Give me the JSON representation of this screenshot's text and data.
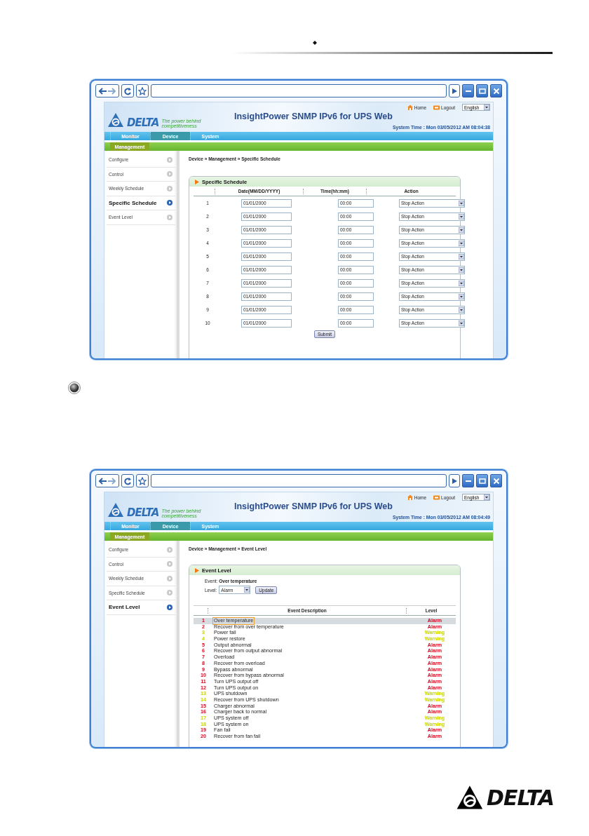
{
  "screens": [
    {
      "kind": "schedule",
      "header": {
        "logo_text": "DELTA",
        "tagline": "The power behind competitiveness",
        "title": "InsightPower SNMP IPv6 for UPS Web",
        "links": [
          "Home",
          "Logout"
        ],
        "language": "English",
        "system_time": "System Time : Mon 03/05/2012 AM 08:04:38"
      },
      "tabs": [
        {
          "label": "Monitor",
          "selected": false
        },
        {
          "label": "Device",
          "selected": true
        },
        {
          "label": "System",
          "selected": false
        }
      ],
      "subtabs": [
        {
          "label": "Management",
          "selected": true
        }
      ],
      "sidebar": [
        {
          "label": "Configure",
          "selected": false
        },
        {
          "label": "Control",
          "selected": false
        },
        {
          "label": "Weekly Schedule",
          "selected": false
        },
        {
          "label": "Specific Schedule",
          "selected": true
        },
        {
          "label": "Event Level",
          "selected": false
        }
      ],
      "breadcrumb": "Device » Management » Specific Schedule",
      "panel": {
        "title": "Specific Schedule",
        "columns": [
          "Date(MM/DD/YYYY)",
          "Time(hh:mm)",
          "Action"
        ],
        "button": "Submit",
        "rows": [
          {
            "number": "1",
            "date": "01/01/2000",
            "time": "00:00",
            "action": "Stop Action"
          },
          {
            "number": "2",
            "date": "01/01/2000",
            "time": "00:00",
            "action": "Stop Action"
          },
          {
            "number": "3",
            "date": "01/01/2000",
            "time": "00:00",
            "action": "Stop Action"
          },
          {
            "number": "4",
            "date": "01/01/2000",
            "time": "00:00",
            "action": "Stop Action"
          },
          {
            "number": "5",
            "date": "01/01/2000",
            "time": "00:00",
            "action": "Stop Action"
          },
          {
            "number": "6",
            "date": "01/01/2000",
            "time": "00:00",
            "action": "Stop Action"
          },
          {
            "number": "7",
            "date": "01/01/2000",
            "time": "00:00",
            "action": "Stop Action"
          },
          {
            "number": "8",
            "date": "01/01/2000",
            "time": "00:00",
            "action": "Stop Action"
          },
          {
            "number": "9",
            "date": "01/01/2000",
            "time": "00:00",
            "action": "Stop Action"
          },
          {
            "number": "10",
            "date": "01/01/2000",
            "time": "00:00",
            "action": "Stop Action"
          }
        ]
      }
    },
    {
      "kind": "event_level",
      "header": {
        "logo_text": "DELTA",
        "tagline": "The power behind competitiveness",
        "title": "InsightPower SNMP IPv6 for UPS Web",
        "links": [
          "Home",
          "Logout"
        ],
        "language": "English",
        "system_time": "System Time : Mon 03/05/2012 AM 08:04:49"
      },
      "tabs": [
        {
          "label": "Monitor",
          "selected": false
        },
        {
          "label": "Device",
          "selected": true
        },
        {
          "label": "System",
          "selected": false
        }
      ],
      "subtabs": [
        {
          "label": "Management",
          "selected": true
        }
      ],
      "sidebar": [
        {
          "label": "Configure",
          "selected": false
        },
        {
          "label": "Control",
          "selected": false
        },
        {
          "label": "Weekly Schedule",
          "selected": false
        },
        {
          "label": "Specific Schedule",
          "selected": false
        },
        {
          "label": "Event Level",
          "selected": true
        }
      ],
      "breadcrumb": "Device » Management » Event Level",
      "panel": {
        "title": "Event Level",
        "event": "Event: **Over temperature**",
        "level_label": "Level:",
        "level_value": "Alarm",
        "button": "Update",
        "columns": [
          "Event Description",
          "Level"
        ],
        "rows": [
          {
            "number": "1",
            "description": "Over temperature",
            "level": "Alarm",
            "color": "#e2001a",
            "selected": true
          },
          {
            "number": "2",
            "description": "Recover from over temperature",
            "level": "Alarm",
            "color": "#e2001a",
            "selected": false
          },
          {
            "number": "3",
            "description": "Power fail",
            "level": "Warning",
            "color": "#c8d400",
            "selected": false
          },
          {
            "number": "4",
            "description": "Power restore",
            "level": "Warning",
            "color": "#c8d400",
            "selected": false
          },
          {
            "number": "5",
            "description": "Output abnormal",
            "level": "Alarm",
            "color": "#e2001a",
            "selected": false
          },
          {
            "number": "6",
            "description": "Recover from output abnormal",
            "level": "Alarm",
            "color": "#e2001a",
            "selected": false
          },
          {
            "number": "7",
            "description": "Overload",
            "level": "Alarm",
            "color": "#e2001a",
            "selected": false
          },
          {
            "number": "8",
            "description": "Recover from overload",
            "level": "Alarm",
            "color": "#e2001a",
            "selected": false
          },
          {
            "number": "9",
            "description": "Bypass abnormal",
            "level": "Alarm",
            "color": "#e2001a",
            "selected": false
          },
          {
            "number": "10",
            "description": "Recover from bypass abnormal",
            "level": "Alarm",
            "color": "#e2001a",
            "selected": false
          },
          {
            "number": "11",
            "description": "Turn UPS output off",
            "level": "Alarm",
            "color": "#e2001a",
            "selected": false
          },
          {
            "number": "12",
            "description": "Turn UPS output on",
            "level": "Alarm",
            "color": "#e2001a",
            "selected": false
          },
          {
            "number": "13",
            "description": "UPS shutdown",
            "level": "Warning",
            "color": "#c8d400",
            "selected": false
          },
          {
            "number": "14",
            "description": "Recover from UPS shutdown",
            "level": "Warning",
            "color": "#c8d400",
            "selected": false
          },
          {
            "number": "15",
            "description": "Charger abnormal",
            "level": "Alarm",
            "color": "#e2001a",
            "selected": false
          },
          {
            "number": "16",
            "description": "Charger back to normal",
            "level": "Alarm",
            "color": "#e2001a",
            "selected": false
          },
          {
            "number": "17",
            "description": "UPS system off",
            "level": "Warning",
            "color": "#c8d400",
            "selected": false
          },
          {
            "number": "18",
            "description": "UPS system on",
            "level": "Warning",
            "color": "#c8d400",
            "selected": false
          },
          {
            "number": "19",
            "description": "Fan fail",
            "level": "Alarm",
            "color": "#e2001a",
            "selected": false
          },
          {
            "number": "20",
            "description": "Recover from fan fail",
            "level": "Alarm",
            "color": "#e2001a",
            "selected": false
          }
        ]
      }
    }
  ],
  "footer_logo": {
    "text": "DELTA"
  }
}
